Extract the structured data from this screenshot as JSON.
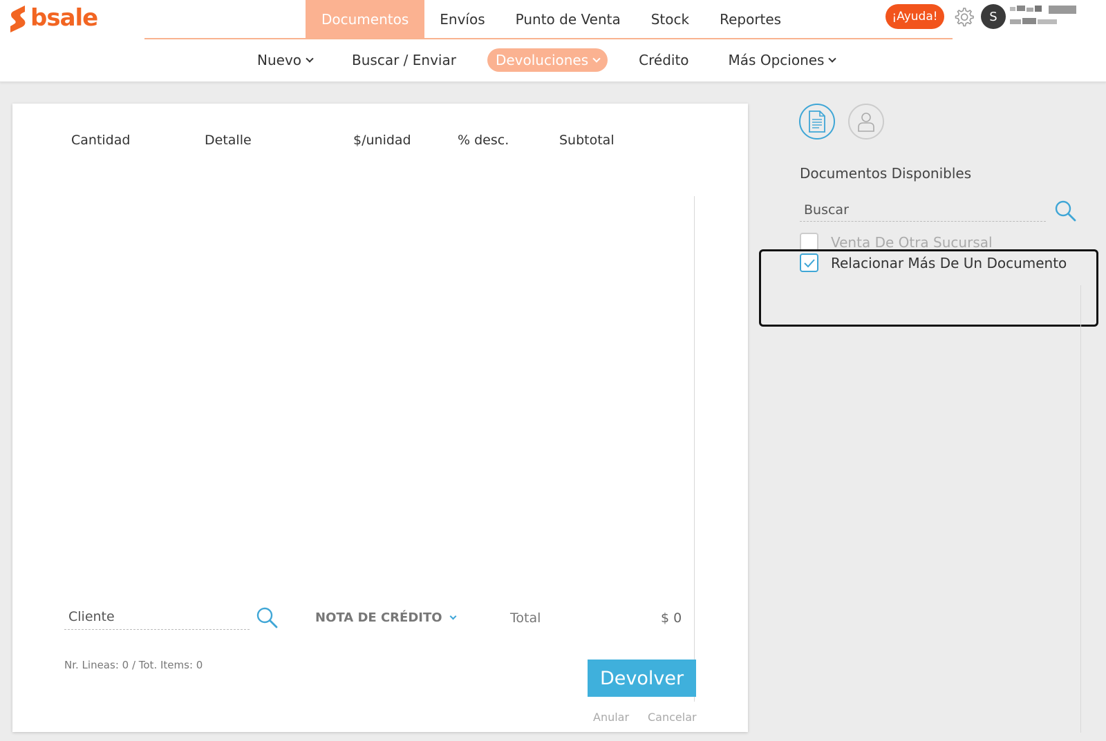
{
  "brand": {
    "name": "bsale",
    "color": "#f26522"
  },
  "topnav": {
    "items": [
      {
        "label": "Documentos",
        "active": true
      },
      {
        "label": "Envíos"
      },
      {
        "label": "Punto de Venta"
      },
      {
        "label": "Stock"
      },
      {
        "label": "Reportes"
      }
    ],
    "help_label": "¡Ayuda!",
    "settings_icon": "gear-icon",
    "avatar_initial": "S"
  },
  "subnav": {
    "items": [
      {
        "label": "Nuevo",
        "dropdown": true
      },
      {
        "label": "Buscar / Enviar"
      },
      {
        "label": "Devoluciones",
        "dropdown": true,
        "active": true
      },
      {
        "label": "Crédito"
      },
      {
        "label": "Más Opciones",
        "dropdown": true
      }
    ]
  },
  "table": {
    "columns": [
      "Cantidad",
      "Detalle",
      "$/unidad",
      "% desc.",
      "Subtotal"
    ],
    "rows": []
  },
  "footer": {
    "cliente_placeholder": "Cliente",
    "doc_type": "NOTA DE CRÉDITO",
    "total_label": "Total",
    "total_value": "$ 0",
    "summary": "Nr. Lineas: 0 / Tot. Items: 0",
    "devolver_label": "Devolver",
    "anular_label": "Anular",
    "cancelar_label": "Cancelar"
  },
  "side_panel": {
    "title": "Documentos Disponibles",
    "search_placeholder": "Buscar",
    "options": [
      {
        "label": "Venta De Otra Sucursal",
        "checked": false
      },
      {
        "label": "Relacionar Más De Un Documento",
        "checked": true
      }
    ]
  },
  "colors": {
    "accent_orange": "#fbb291",
    "help_orange": "#f2541c",
    "accent_blue": "#3fb0dc"
  }
}
